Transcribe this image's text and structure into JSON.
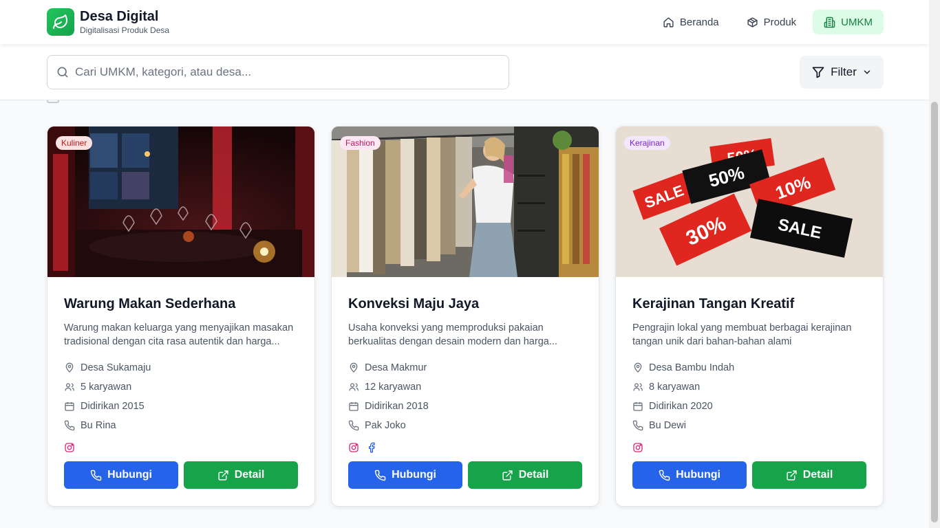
{
  "brand": {
    "title": "Desa Digital",
    "subtitle": "Digitalisasi Produk Desa"
  },
  "nav": [
    {
      "label": "Beranda",
      "icon": "home-icon"
    },
    {
      "label": "Produk",
      "icon": "box-icon"
    },
    {
      "label": "UMKM",
      "icon": "building-icon",
      "active": true
    }
  ],
  "search": {
    "placeholder": "Cari UMKM, kategori, atau desa...",
    "value": ""
  },
  "filter": {
    "label": "Filter"
  },
  "cards": [
    {
      "category": "Kuliner",
      "category_color": "#fee2e2",
      "category_text": "#b91c1c",
      "title": "Warung Makan Sederhana",
      "description": "Warung makan keluarga yang menyajikan masakan tradisional dengan cita rasa autentik dan harga...",
      "location": "Desa Sukamaju",
      "employees": "5 karyawan",
      "founded": "Didirikan 2015",
      "contact": "Bu Rina",
      "socials": [
        "instagram-icon"
      ],
      "contact_button": "Hubungi",
      "detail_button": "Detail"
    },
    {
      "category": "Fashion",
      "category_color": "#fce7f3",
      "category_text": "#be185d",
      "title": "Konveksi Maju Jaya",
      "description": "Usaha konveksi yang memproduksi pakaian berkualitas dengan desain modern dan harga...",
      "location": "Desa Makmur",
      "employees": "12 karyawan",
      "founded": "Didirikan 2018",
      "contact": "Pak Joko",
      "socials": [
        "instagram-icon",
        "facebook-icon"
      ],
      "contact_button": "Hubungi",
      "detail_button": "Detail"
    },
    {
      "category": "Kerajinan",
      "category_color": "#f3e8ff",
      "category_text": "#7e22ce",
      "title": "Kerajinan Tangan Kreatif",
      "description": "Pengrajin lokal yang membuat berbagai kerajinan tangan unik dari bahan-bahan alami",
      "location": "Desa Bambu Indah",
      "employees": "8 karyawan",
      "founded": "Didirikan 2020",
      "contact": "Bu Dewi",
      "socials": [
        "instagram-icon"
      ],
      "contact_button": "Hubungi",
      "detail_button": "Detail"
    }
  ],
  "image_texts": {
    "sale1": "50%",
    "sale2": "50%",
    "sale3": "SALE",
    "sale4": "10%",
    "sale5": "30%",
    "sale6": "SALE"
  },
  "colors": {
    "accent": "#16a34a",
    "primary_button": "#2563eb",
    "active_nav_bg": "#dcfce7"
  }
}
